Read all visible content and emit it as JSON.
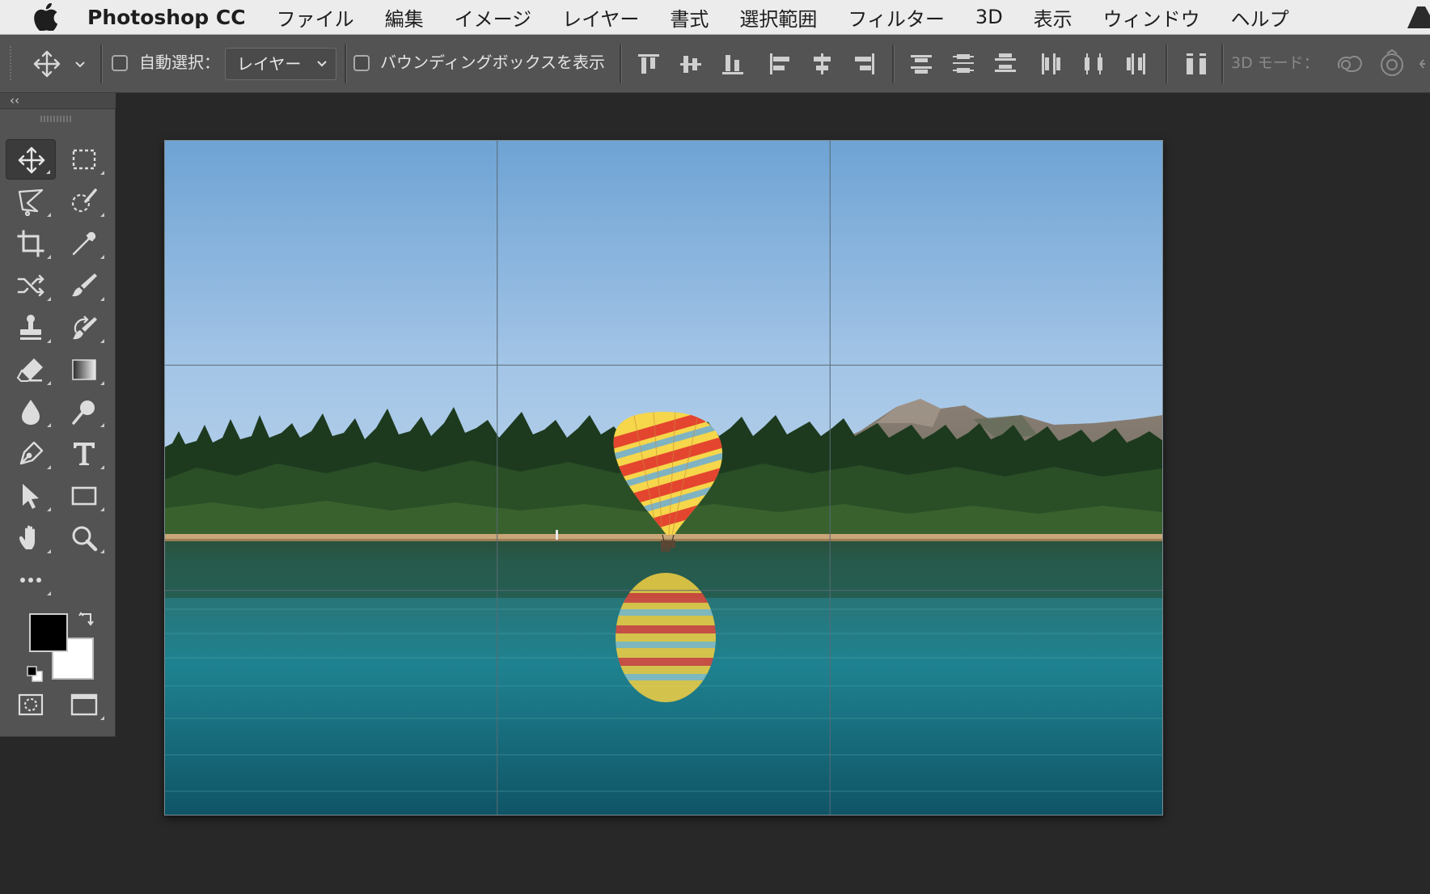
{
  "menubar": {
    "app_name": "Photoshop CC",
    "items": [
      "ファイル",
      "編集",
      "イメージ",
      "レイヤー",
      "書式",
      "選択範囲",
      "フィルター",
      "3D",
      "表示",
      "ウィンドウ",
      "ヘルプ"
    ]
  },
  "options_bar": {
    "auto_select_label": "自動選択：",
    "auto_select_target": "レイヤー",
    "show_bounding_box_label": "バウンディングボックスを表示",
    "mode_3d_label": "3D モード："
  },
  "toolbox": {
    "collapse_label": "‹‹",
    "foreground_color": "#000000",
    "background_color": "#ffffff"
  },
  "colors": {
    "menubar_bg": "#ececec",
    "panel_bg": "#535353",
    "workspace_bg": "#282828"
  }
}
